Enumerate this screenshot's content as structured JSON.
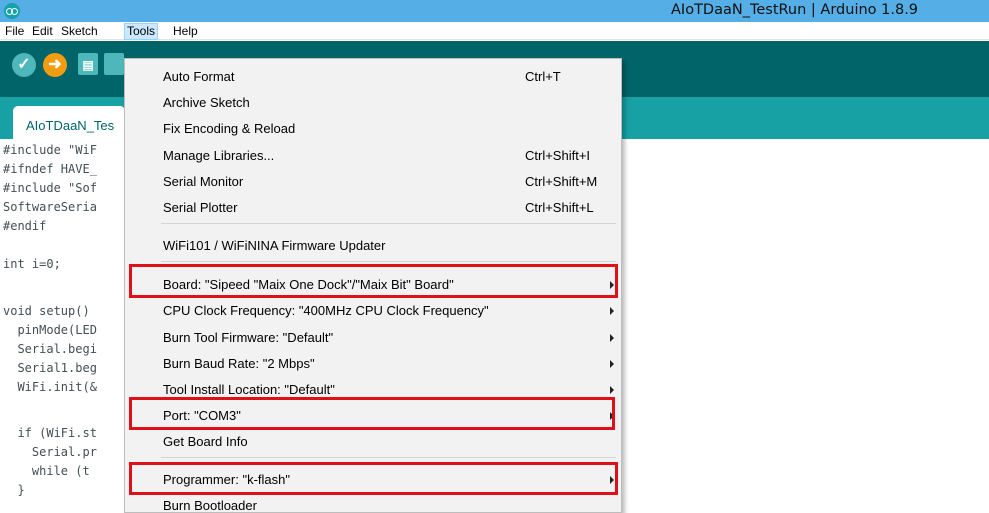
{
  "window": {
    "title": "AIoTDaaN_TestRun | Arduino 1.8.9"
  },
  "menubar": {
    "items": [
      {
        "label": "File"
      },
      {
        "label": "Edit"
      },
      {
        "label": "Sketch"
      },
      {
        "label": "Tools"
      },
      {
        "label": "Help"
      }
    ]
  },
  "toolbar": {
    "verify_icon": "check-icon",
    "upload_icon": "arrow-right-icon",
    "new_icon": "file-icon"
  },
  "tab": {
    "label": "AIoTDaaN_Tes"
  },
  "code_lines": [
    "#include \"WiF",
    "#ifndef HAVE_",
    "#include \"Sof",
    "SoftwareSeria",
    "#endif",
    "",
    "int i=0;",
    "",
    "void setup()",
    "  pinMode(LED",
    "  Serial.begi",
    "  Serial1.beg",
    "  WiFi.init(&",
    "",
    "  if (WiFi.st",
    "    Serial.pr",
    "    while (t",
    "  }"
  ],
  "tools_menu": {
    "items": [
      {
        "label": "Auto Format",
        "shortcut": "Ctrl+T"
      },
      {
        "label": "Archive Sketch",
        "shortcut": ""
      },
      {
        "label": "Fix Encoding & Reload",
        "shortcut": ""
      },
      {
        "label": "Manage Libraries...",
        "shortcut": "Ctrl+Shift+I"
      },
      {
        "label": "Serial Monitor",
        "shortcut": "Ctrl+Shift+M"
      },
      {
        "label": "Serial Plotter",
        "shortcut": "Ctrl+Shift+L"
      },
      {
        "label": "WiFi101 / WiFiNINA Firmware Updater",
        "shortcut": ""
      },
      {
        "label": "Board: \"Sipeed \"Maix One Dock\"/\"Maix Bit\" Board\"",
        "shortcut": ""
      },
      {
        "label": "CPU Clock Frequency: \"400MHz CPU Clock Frequency\"",
        "shortcut": ""
      },
      {
        "label": "Burn Tool Firmware: \"Default\"",
        "shortcut": ""
      },
      {
        "label": "Burn Baud Rate: \"2 Mbps\"",
        "shortcut": ""
      },
      {
        "label": "Tool Install Location: \"Default\"",
        "shortcut": ""
      },
      {
        "label": "Port: \"COM3\"",
        "shortcut": ""
      },
      {
        "label": "Get Board Info",
        "shortcut": ""
      },
      {
        "label": "Programmer: \"k-flash\"",
        "shortcut": ""
      },
      {
        "label": "Burn Bootloader",
        "shortcut": ""
      }
    ]
  },
  "colors": {
    "titlebar": "#56aee6",
    "toolbar": "#006468",
    "tabstrip": "#17a1a5",
    "highlight": "#e0101b"
  }
}
